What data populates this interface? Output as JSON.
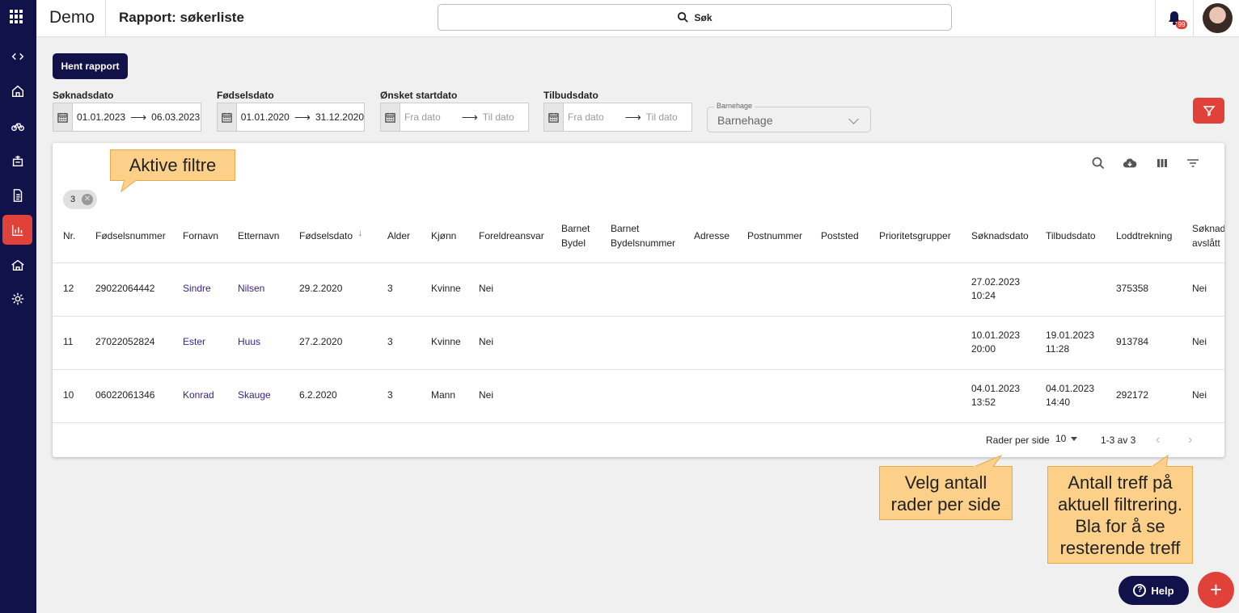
{
  "app": {
    "brand": "Demo",
    "page_title": "Rapport: søkerliste",
    "search_label": "Søk",
    "notification_count": "99"
  },
  "sidebar": {
    "items": [
      "expand-collapse",
      "home",
      "bike",
      "playground",
      "document",
      "reports",
      "kindergarten",
      "settings"
    ],
    "active": "reports"
  },
  "toolbar": {
    "fetch_report": "Hent rapport"
  },
  "filters": {
    "soknadsdato": {
      "label": "Søknadsdato",
      "from": "01.01.2023",
      "to": "06.03.2023"
    },
    "fodselsdato": {
      "label": "Fødselsdato",
      "from": "01.01.2020",
      "to": "31.12.2020"
    },
    "startdato": {
      "label": "Ønsket startdato",
      "from_placeholder": "Fra dato",
      "to_placeholder": "Til dato"
    },
    "tilbudsdato": {
      "label": "Tilbudsdato",
      "from_placeholder": "Fra dato",
      "to_placeholder": "Til dato"
    },
    "barnehage": {
      "label": "Barnehage",
      "value": "Barnehage"
    }
  },
  "active_filters": {
    "count": "3"
  },
  "table": {
    "columns": [
      "Nr.",
      "Fødselsnummer",
      "Fornavn",
      "Etternavn",
      "Fødselsdato",
      "Alder",
      "Kjønn",
      "Foreldreansvar",
      "Barnet Bydel",
      "Barnet Bydelsnummer",
      "Adresse",
      "Postnummer",
      "Poststed",
      "Prioritetsgrupper",
      "Søknadsdato",
      "Tilbudsdato",
      "Loddtrekning",
      "Søknad avslått"
    ],
    "header_lines": {
      "barnet_bydel": [
        "Barnet",
        "Bydel"
      ],
      "barnet_bydelsnummer": [
        "Barnet",
        "Bydelsnummer"
      ],
      "soknad_avslatt": [
        "Søknad",
        "avslått"
      ]
    },
    "sort_column": "Fødselsdato",
    "rows": [
      {
        "nr": "12",
        "fnr": "29022064442",
        "fornavn": "Sindre",
        "etternavn": "Nilsen",
        "fodselsdato": "29.2.2020",
        "alder": "3",
        "kjonn": "Kvinne",
        "foreldreansvar": "Nei",
        "soknadsdato_date": "27.02.2023",
        "soknadsdato_time": "10:24",
        "tilbudsdato_date": "",
        "tilbudsdato_time": "",
        "loddtrekning": "375358",
        "avslatt": "Nei"
      },
      {
        "nr": "11",
        "fnr": "27022052824",
        "fornavn": "Ester",
        "etternavn": "Huus",
        "fodselsdato": "27.2.2020",
        "alder": "3",
        "kjonn": "Kvinne",
        "foreldreansvar": "Nei",
        "soknadsdato_date": "10.01.2023",
        "soknadsdato_time": "20:00",
        "tilbudsdato_date": "19.01.2023",
        "tilbudsdato_time": "11:28",
        "loddtrekning": "913784",
        "avslatt": "Nei"
      },
      {
        "nr": "10",
        "fnr": "06022061346",
        "fornavn": "Konrad",
        "etternavn": "Skauge",
        "fodselsdato": "6.2.2020",
        "alder": "3",
        "kjonn": "Mann",
        "foreldreansvar": "Nei",
        "soknadsdato_date": "04.01.2023",
        "soknadsdato_time": "13:52",
        "tilbudsdato_date": "04.01.2023",
        "tilbudsdato_time": "14:40",
        "loddtrekning": "292172",
        "avslatt": "Nei"
      }
    ]
  },
  "pagination": {
    "rows_per_page_label": "Rader per side",
    "rows_per_page": "10",
    "range": "1-3 av 3"
  },
  "callouts": {
    "active_filters": "Aktive filtre",
    "rows_per_page": [
      "Velg antall",
      "rader per side"
    ],
    "result_count": [
      "Antall treff på",
      "aktuell filtrering.",
      "Bla for å se",
      "resterende treff"
    ]
  },
  "fab": {
    "help": "Help",
    "add": "+"
  },
  "colors": {
    "navy": "#12124a",
    "accent": "#e0423a",
    "callout": "#fdd08a",
    "link": "#3a2282"
  }
}
